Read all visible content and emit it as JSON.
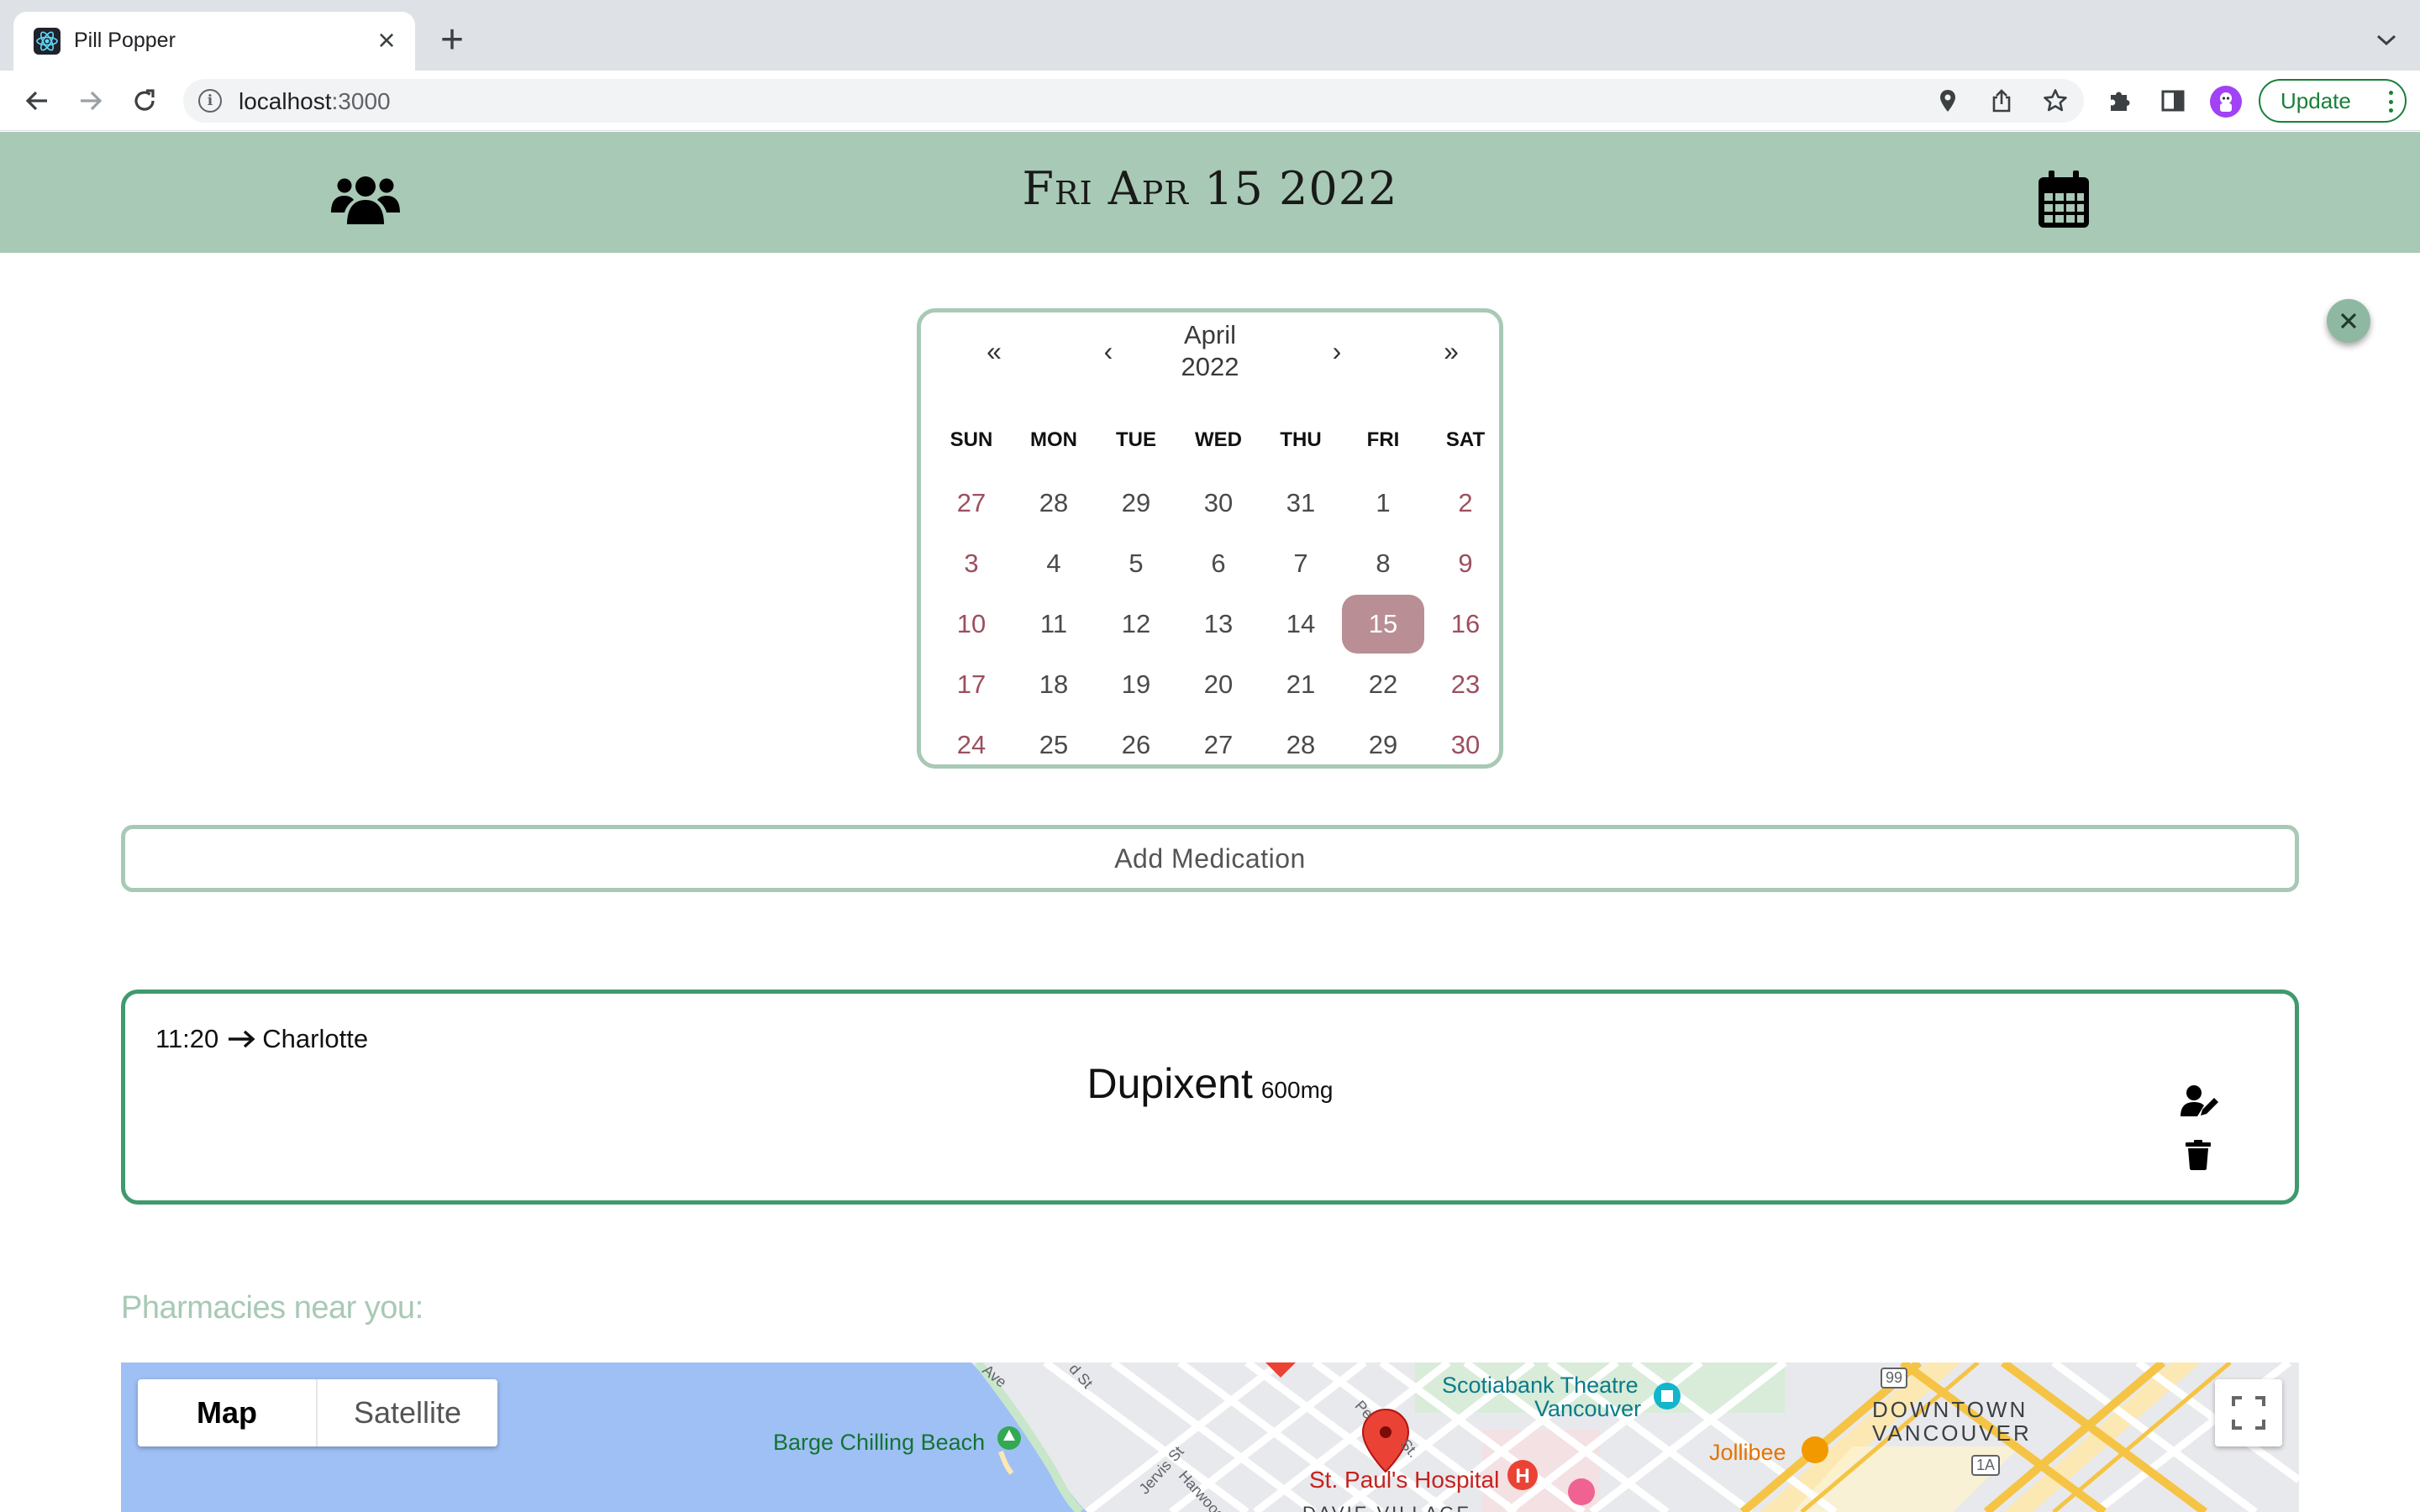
{
  "browser": {
    "tab_title": "Pill Popper",
    "url_host": "localhost",
    "url_port": ":3000",
    "update_label": "Update"
  },
  "header": {
    "title": "Fri Apr 15 2022"
  },
  "calendar": {
    "prev_year": "«",
    "prev_month": "‹",
    "month": "April",
    "year": "2022",
    "next_month": "›",
    "next_year": "»",
    "weekdays": [
      "SUN",
      "MON",
      "TUE",
      "WED",
      "THU",
      "FRI",
      "SAT"
    ],
    "weeks": [
      [
        "27",
        "28",
        "29",
        "30",
        "31",
        "1",
        "2"
      ],
      [
        "3",
        "4",
        "5",
        "6",
        "7",
        "8",
        "9"
      ],
      [
        "10",
        "11",
        "12",
        "13",
        "14",
        "15",
        "16"
      ],
      [
        "17",
        "18",
        "19",
        "20",
        "21",
        "22",
        "23"
      ],
      [
        "24",
        "25",
        "26",
        "27",
        "28",
        "29",
        "30"
      ]
    ],
    "selected_day": "15"
  },
  "add_medication_label": "Add Medication",
  "medication": {
    "time": "11:20",
    "person": "Charlotte",
    "name": "Dupixent",
    "dose": "600mg"
  },
  "pharmacies": {
    "heading": "Pharmacies near you:",
    "map_type_map": "Map",
    "map_type_satellite": "Satellite",
    "places": {
      "beach": "Barge Chilling Beach",
      "hospital": "St. Paul's Hospital",
      "theatre_line1": "Scotiabank Theatre",
      "theatre_line2": "Vancouver",
      "restaurant": "Jollibee",
      "district_line1": "DOWNTOWN",
      "district_line2": "VANCOUVER",
      "district_bottom": "DAVIE VILLAGE",
      "route_99": "99",
      "route_1a": "1A",
      "street_jervis": "Jervis St",
      "street_harwood": "Harwood",
      "street_ave": "Ave",
      "street_d": "d St",
      "street_p": "Pe",
      "street_st": "St."
    }
  },
  "colors": {
    "header_green": "#a8c9b5",
    "card_border": "#3f9a6e",
    "selected_day": "#b98e95",
    "weekend_day": "#9c4f5e",
    "map_water": "#9fc0f5"
  },
  "icons": {
    "header_left": "users-icon",
    "header_right": "calendar-icon",
    "edit": "user-edit-icon",
    "delete": "trash-icon",
    "close": "close-icon"
  }
}
